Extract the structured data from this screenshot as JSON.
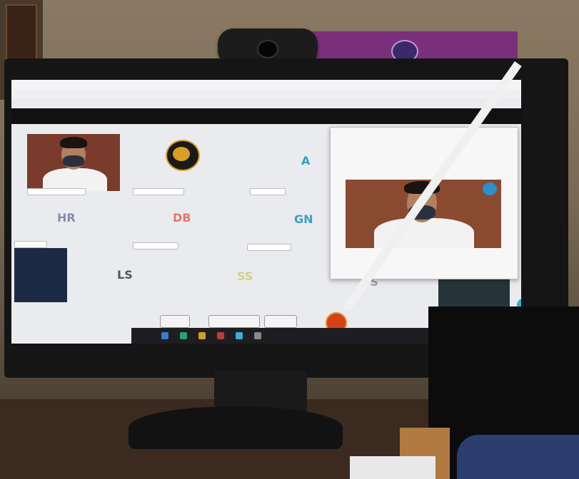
{
  "participants": [
    {
      "initials": "A",
      "color": "#38a0b8"
    },
    {
      "initials": "HR",
      "color": "#8a8ab0"
    },
    {
      "initials": "DB",
      "color": "#e07a6a"
    },
    {
      "initials": "GN",
      "color": "#3aa0c8"
    },
    {
      "initials": "LS",
      "color": "#555555"
    },
    {
      "initials": "VS",
      "color": "#9aa0b0"
    },
    {
      "initials": "SS",
      "color": "#d8cf80"
    }
  ],
  "colors": {
    "leave_button": "#d8401a",
    "taskbar": "#1e1e22",
    "top_monitor": "#7a2f7a"
  },
  "icons": [
    "webcam-icon",
    "emblem-logo-icon",
    "leave-call-icon",
    "chat-bubble-icon"
  ]
}
